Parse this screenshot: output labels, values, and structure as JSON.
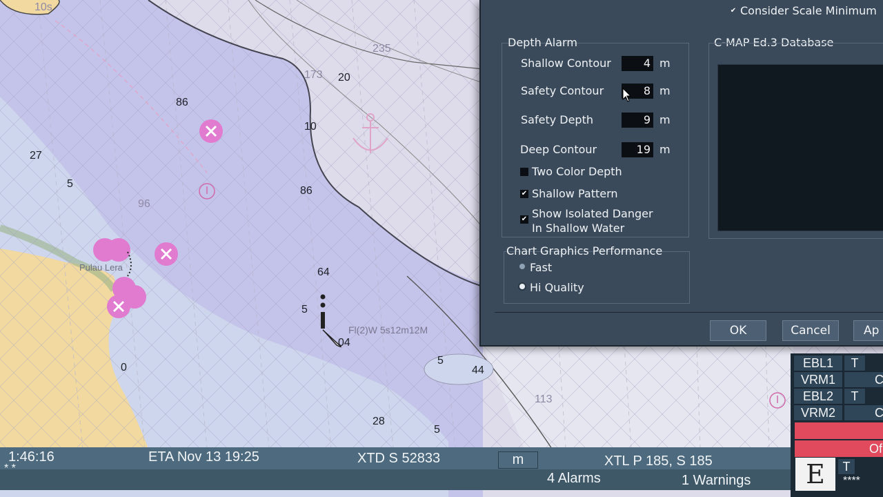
{
  "chart": {
    "depth_labels": [
      {
        "text": "10s",
        "faint": true
      },
      {
        "text": "235",
        "faint": true
      },
      {
        "text": "173",
        "faint": true
      },
      {
        "text": "20"
      },
      {
        "text": "86"
      },
      {
        "text": "10"
      },
      {
        "text": "27"
      },
      {
        "text": "5"
      },
      {
        "text": "96",
        "faint": true
      },
      {
        "text": "86"
      },
      {
        "text": "64"
      },
      {
        "text": "5"
      },
      {
        "text": "04"
      },
      {
        "text": "5"
      },
      {
        "text": "44"
      },
      {
        "text": "0"
      },
      {
        "text": "28"
      },
      {
        "text": "5"
      },
      {
        "text": "113",
        "faint": true
      }
    ],
    "place_name": "Pulau Lera",
    "light_label": "Fl(2)W 5s12m12M"
  },
  "dialog": {
    "consider_scale": {
      "label": "Consider Scale Minimum",
      "checked": true
    },
    "depth_alarm": {
      "title": "Depth Alarm",
      "fields": [
        {
          "label": "Shallow Contour",
          "value": "4",
          "unit": "m"
        },
        {
          "label": "Safety Contour",
          "value": "8",
          "unit": "m"
        },
        {
          "label": "Safety Depth",
          "value": "9",
          "unit": "m"
        },
        {
          "label": "Deep Contour",
          "value": "19",
          "unit": "m"
        }
      ],
      "checkboxes": [
        {
          "label": "Two Color Depth",
          "checked": false
        },
        {
          "label": "Shallow Pattern",
          "checked": true
        },
        {
          "label": "Show Isolated Danger",
          "label2": "In Shallow Water",
          "checked": true
        }
      ]
    },
    "database": {
      "title": "C-MAP Ed.3 Database"
    },
    "performance": {
      "title": "Chart Graphics Performance",
      "options": [
        {
          "label": "Fast",
          "selected": false
        },
        {
          "label": "Hi Quality",
          "selected": true
        }
      ]
    },
    "buttons": {
      "ok": "OK",
      "cancel": "Cancel",
      "apply": "Ap"
    }
  },
  "status": {
    "time": "1:46:16",
    "asterisks": "* *",
    "eta": "ETA Nov 13 19:25",
    "xtd": "XTD S 52833",
    "unit": "m",
    "xtl": "XTL P 185, S 185",
    "alarms": "4 Alarms",
    "warnings": "1 Warnings"
  },
  "side_panel": {
    "rows": [
      {
        "label": "EBL1",
        "mode": "T"
      },
      {
        "label": "VRM1",
        "mode": "C"
      },
      {
        "label": "EBL2",
        "mode": "T"
      },
      {
        "label": "VRM2",
        "mode": "C"
      }
    ],
    "off_label": "Of",
    "mode_letter": "E",
    "mode_t": "T",
    "bottom_stars": "****"
  },
  "colors": {
    "land": "#f1d9a0",
    "shallow": "#c9d3ea",
    "medium": "#bcc0e8",
    "deep": "#dcdcec",
    "danger": "#e07bd0",
    "dialog_bg": "#3b4a5a",
    "alarm_red": "#e04a5c"
  }
}
